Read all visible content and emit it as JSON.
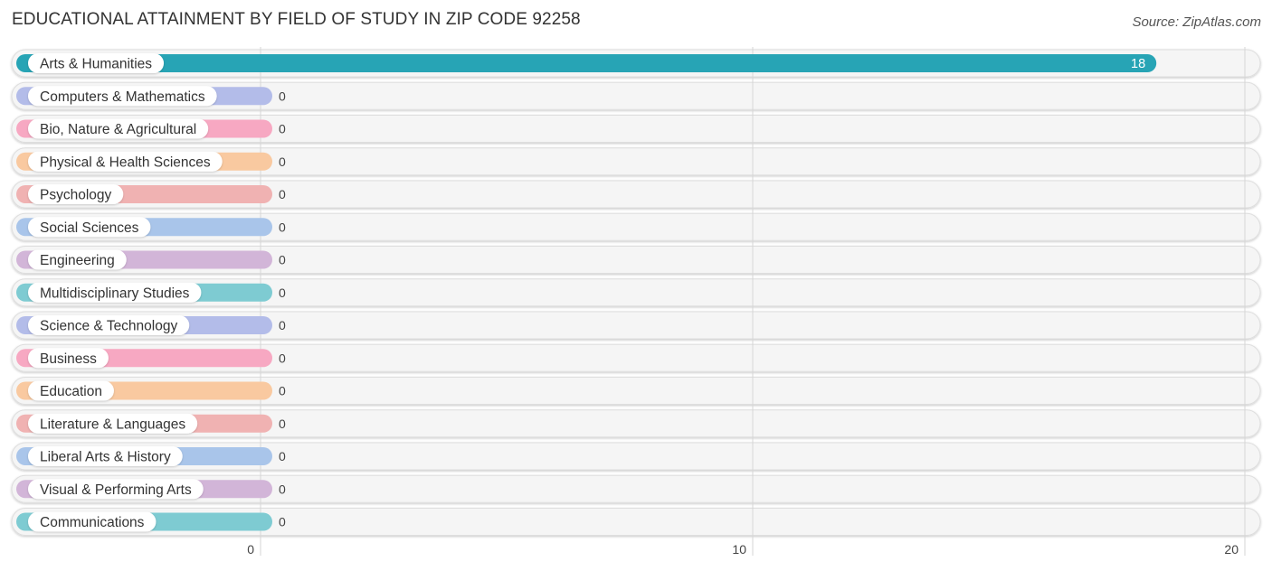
{
  "header": {
    "title": "EDUCATIONAL ATTAINMENT BY FIELD OF STUDY IN ZIP CODE 92258",
    "source": "Source: ZipAtlas.com"
  },
  "chart_data": {
    "type": "bar",
    "orientation": "horizontal",
    "title": "EDUCATIONAL ATTAINMENT BY FIELD OF STUDY IN ZIP CODE 92258",
    "xlabel": "",
    "ylabel": "",
    "xlim": [
      0,
      20
    ],
    "xticks": [
      0,
      10,
      20
    ],
    "xtick_labels": [
      "0",
      "10",
      "20"
    ],
    "grid": true,
    "categories": [
      "Arts & Humanities",
      "Computers & Mathematics",
      "Bio, Nature & Agricultural",
      "Physical & Health Sciences",
      "Psychology",
      "Social Sciences",
      "Engineering",
      "Multidisciplinary Studies",
      "Science & Technology",
      "Business",
      "Education",
      "Literature & Languages",
      "Liberal Arts & History",
      "Visual & Performing Arts",
      "Communications"
    ],
    "values": [
      18,
      0,
      0,
      0,
      0,
      0,
      0,
      0,
      0,
      0,
      0,
      0,
      0,
      0,
      0
    ],
    "value_labels": [
      "18",
      "0",
      "0",
      "0",
      "0",
      "0",
      "0",
      "0",
      "0",
      "0",
      "0",
      "0",
      "0",
      "0",
      "0"
    ],
    "colors": [
      "#27a4b5",
      "#b3bce9",
      "#f7a8c2",
      "#f9c9a0",
      "#f0b2b2",
      "#a9c5ea",
      "#d2b5d8",
      "#7ecbd2",
      "#b3bce9",
      "#f7a8c2",
      "#f9c9a0",
      "#f0b2b2",
      "#a9c5ea",
      "#d2b5d8",
      "#7ecbd2"
    ]
  }
}
